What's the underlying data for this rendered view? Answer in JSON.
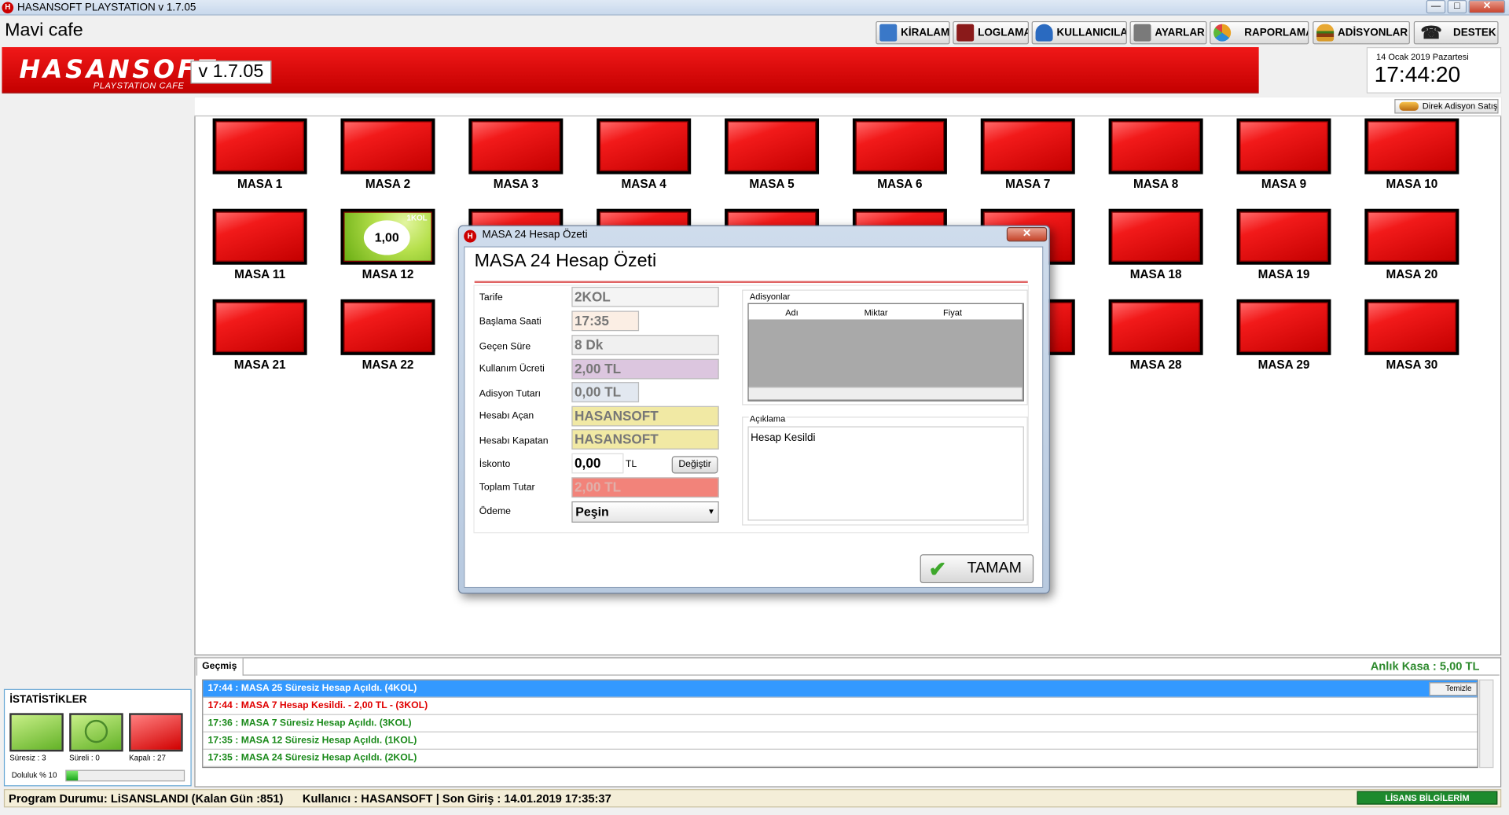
{
  "window": {
    "title": "HASANSOFT PLAYSTATION v 1.7.05",
    "app_icon_letter": "H",
    "min": "—",
    "max": "□",
    "close": "✕"
  },
  "header": {
    "cafe_name": "Mavi cafe",
    "logo_main": "HASANSOFT",
    "logo_sub": "PLAYSTATION CAFE",
    "version": "v 1.7.05",
    "date": "14 Ocak 2019 Pazartesi",
    "time": "17:44:20",
    "toolbar": [
      {
        "label": "KİRALAMA",
        "icon": "house-icon",
        "color": "#3a78c8"
      },
      {
        "label": "LOGLAMA",
        "icon": "log-icon",
        "color": "#8a1a1a"
      },
      {
        "label": "KULLANICILAR",
        "icon": "user-icon",
        "color": "#2a6ac0"
      },
      {
        "label": "AYARLAR",
        "icon": "tools-icon",
        "color": "#7a7a7a"
      },
      {
        "label": "RAPORLAMA",
        "icon": "pie-chart-icon",
        "color": "#e8a020"
      },
      {
        "label": "ADİSYONLAR",
        "icon": "burger-icon",
        "color": "#d48a1a"
      },
      {
        "label": "DESTEK",
        "icon": "phone-icon",
        "color": "#222222"
      }
    ],
    "direk_button": "Direk Adisyon Satış"
  },
  "tables": [
    {
      "label": "MASA 1"
    },
    {
      "label": "MASA 2"
    },
    {
      "label": "MASA 3"
    },
    {
      "label": "MASA 4"
    },
    {
      "label": "MASA 5"
    },
    {
      "label": "MASA 6"
    },
    {
      "label": "MASA 7"
    },
    {
      "label": "MASA 8"
    },
    {
      "label": "MASA 9"
    },
    {
      "label": "MASA 10"
    },
    {
      "label": "MASA 11"
    },
    {
      "label": "MASA 12",
      "status": "open",
      "badge": "1KOL",
      "value": "1,00"
    },
    {
      "label": "MASA 18"
    },
    {
      "label": "MASA 19"
    },
    {
      "label": "MASA 20"
    },
    {
      "label": "MASA 21"
    },
    {
      "label": "MASA 22"
    },
    {
      "label": "MASA 28"
    },
    {
      "label": "MASA 29"
    },
    {
      "label": "MASA 30"
    }
  ],
  "dialog": {
    "title": "MASA 24 Hesap Özeti",
    "heading": "MASA 24 Hesap Özeti",
    "fields": {
      "tarife": {
        "label": "Tarife",
        "value": "2KOL",
        "bg": "#f4f4f4"
      },
      "baslama": {
        "label": "Başlama Saati",
        "value": "17:35",
        "bg": "#fbeee4"
      },
      "gecen": {
        "label": "Geçen Süre",
        "value": "8 Dk",
        "bg": "#f0f0f0"
      },
      "ucret": {
        "label": "Kullanım Ücreti",
        "value": "2,00 TL",
        "bg": "#dcc6df"
      },
      "adisyon": {
        "label": "Adisyon Tutarı",
        "value": "0,00 TL",
        "bg": "#e2e8f0"
      },
      "acan": {
        "label": "Hesabı Açan",
        "value": "HASANSOFT",
        "bg": "#f1e9a4"
      },
      "kapatan": {
        "label": "Hesabı Kapatan",
        "value": "HASANSOFT",
        "bg": "#f1e9a4"
      },
      "toplam": {
        "label": "Toplam Tutar",
        "value": "2,00 TL",
        "bg": "#f2837a"
      }
    },
    "iskonto": {
      "label": "İskonto",
      "value": "0,00",
      "unit": "TL",
      "button": "Değiştir"
    },
    "odeme": {
      "label": "Ödeme",
      "value": "Peşin"
    },
    "adisyonlar": {
      "legend": "Adisyonlar",
      "columns": [
        "Adı",
        "Miktar",
        "Fiyat"
      ]
    },
    "aciklama": {
      "legend": "Açıklama",
      "text": "Hesap Kesildi"
    },
    "ok_button": "TAMAM"
  },
  "history": {
    "tab": "Geçmiş",
    "anlik_kasa": "Anlık Kasa : 5,00 TL",
    "clear_button": "Temizle",
    "entries": [
      {
        "text": "17:44 : MASA 25 Süresiz Hesap Açıldı. (4KOL)",
        "color": "#ffffff",
        "selected": true
      },
      {
        "text": "17:44 : MASA 7 Hesap Kesildi. - 2,00 TL - (3KOL)",
        "color": "#e00000"
      },
      {
        "text": "17:36 : MASA 7 Süresiz Hesap Açıldı. (3KOL)",
        "color": "#1a8a1a"
      },
      {
        "text": "17:35 : MASA 12 Süresiz Hesap Açıldı. (1KOL)",
        "color": "#1a8a1a"
      },
      {
        "text": "17:35 : MASA 24 Süresiz Hesap Açıldı. (2KOL)",
        "color": "#1a8a1a"
      }
    ]
  },
  "stats": {
    "title": "İSTATİSTİKLER",
    "suresiz": "Süresiz : 3",
    "sureli": "Süreli : 0",
    "kapali": "Kapalı : 27",
    "doluluk_label": "Doluluk % 10",
    "doluluk_percent": 10
  },
  "status_bar": {
    "text": "Program Durumu: LiSANSLANDI (Kalan Gün :851)      Kullanıcı : HASANSOFT | Son Giriş : 14.01.2019 17:35:37",
    "license_button": "LİSANS BİLGİLERİM"
  }
}
